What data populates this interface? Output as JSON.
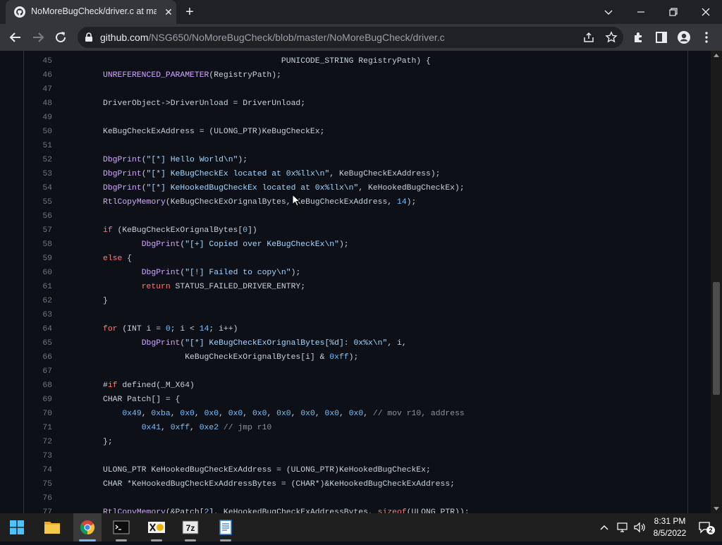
{
  "browser": {
    "tab": {
      "title": "NoMoreBugCheck/driver.c at ma",
      "favicon": "github-icon"
    },
    "new_tab": "+",
    "omnibox": {
      "url_host": "github.com",
      "url_path": "/NSG650/NoMoreBugCheck/blob/master/NoMoreBugCheck/driver.c"
    },
    "toolbar_icons": [
      "back-icon",
      "forward-icon",
      "reload-icon",
      "lock-icon",
      "share-icon",
      "star-icon",
      "extensions-icon",
      "side-panel-icon",
      "profile-icon",
      "menu-icon"
    ]
  },
  "code": {
    "lines": [
      {
        "n": "45",
        "html": "                                     PUNICODE_STRING RegistryPath) {"
      },
      {
        "n": "46",
        "html": "<span class=\"fn\">UNREFERENCED_PARAMETER</span>(RegistryPath);"
      },
      {
        "n": "47",
        "html": ""
      },
      {
        "n": "48",
        "html": "DriverObject-&gt;DriverUnload = DriverUnload;"
      },
      {
        "n": "49",
        "html": ""
      },
      {
        "n": "50",
        "html": "KeBugCheckExAddress = (ULONG_PTR)KeBugCheckEx;"
      },
      {
        "n": "51",
        "html": ""
      },
      {
        "n": "52",
        "html": "<span class=\"fn\">DbgPrint</span>(<span class=\"st\">\"[*] Hello World\\n\"</span>);"
      },
      {
        "n": "53",
        "html": "<span class=\"fn\">DbgPrint</span>(<span class=\"st\">\"[*] KeBugCheckEx located at 0x%llx\\n\"</span>, KeBugCheckExAddress);"
      },
      {
        "n": "54",
        "html": "<span class=\"fn\">DbgPrint</span>(<span class=\"st\">\"[*] KeHookedBugCheckEx located at 0x%llx\\n\"</span>, KeHookedBugCheckEx);"
      },
      {
        "n": "55",
        "html": "<span class=\"fn\">RtlCopyMemory</span>(KeBugCheckExOrignalBytes, KeBugCheckExAddress, <span class=\"nu\">14</span>);"
      },
      {
        "n": "56",
        "html": ""
      },
      {
        "n": "57",
        "html": "<span class=\"kw\">if</span> (KeBugCheckExOrignalBytes[<span class=\"nu\">0</span>])"
      },
      {
        "n": "58",
        "html": "        <span class=\"fn\">DbgPrint</span>(<span class=\"st\">\"[+] Copied over KeBugCheckEx\\n\"</span>);"
      },
      {
        "n": "59",
        "html": "<span class=\"kw\">else</span> {"
      },
      {
        "n": "60",
        "html": "        <span class=\"fn\">DbgPrint</span>(<span class=\"st\">\"[!] Failed to copy\\n\"</span>);"
      },
      {
        "n": "61",
        "html": "        <span class=\"kw\">return</span> STATUS_FAILED_DRIVER_ENTRY;"
      },
      {
        "n": "62",
        "html": "}"
      },
      {
        "n": "63",
        "html": ""
      },
      {
        "n": "64",
        "html": "<span class=\"kw\">for</span> (INT i = <span class=\"nu\">0</span>; i &lt; <span class=\"nu\">14</span>; i++)"
      },
      {
        "n": "65",
        "html": "        <span class=\"fn\">DbgPrint</span>(<span class=\"st\">\"[*] KeBugCheckExOrignalBytes[%d]: 0x%x\\n\"</span>, i,"
      },
      {
        "n": "66",
        "html": "                 KeBugCheckExOrignalBytes[i] &amp; <span class=\"nu\">0xff</span>);"
      },
      {
        "n": "67",
        "html": ""
      },
      {
        "n": "68",
        "html": "#<span class=\"kw\">if</span> defined(_M_X64)"
      },
      {
        "n": "69",
        "html": "CHAR Patch[] = {"
      },
      {
        "n": "70",
        "html": "    <span class=\"nu\">0x49</span>, <span class=\"nu\">0xba</span>, <span class=\"nu\">0x0</span>, <span class=\"nu\">0x0</span>, <span class=\"nu\">0x0</span>, <span class=\"nu\">0x0</span>, <span class=\"nu\">0x0</span>, <span class=\"nu\">0x0</span>, <span class=\"nu\">0x0</span>, <span class=\"nu\">0x0</span>, <span class=\"cm\">// mov r10, address</span>"
      },
      {
        "n": "71",
        "html": "        <span class=\"nu\">0x41</span>, <span class=\"nu\">0xff</span>, <span class=\"nu\">0xe2</span> <span class=\"cm\">// jmp r10</span>"
      },
      {
        "n": "72",
        "html": "};"
      },
      {
        "n": "73",
        "html": ""
      },
      {
        "n": "74",
        "html": "ULONG_PTR KeHookedBugCheckExAddress = (ULONG_PTR)KeHookedBugCheckEx;"
      },
      {
        "n": "75",
        "html": "CHAR *KeHookedBugCheckExAddressBytes = (CHAR*)&amp;KeHookedBugCheckExAddress;"
      },
      {
        "n": "76",
        "html": ""
      },
      {
        "n": "77",
        "html": "<span class=\"fn\">RtlCopyMemory</span>(&amp;Patch[<span class=\"nu\">2</span>], KeHookedBugCheckExAddressBytes, <span class=\"kw\">sizeof</span>(ULONG_PTR));"
      }
    ]
  },
  "taskbar": {
    "apps": [
      {
        "name": "start-button",
        "icon": "windows-icon"
      },
      {
        "name": "file-explorer",
        "icon": "folder-icon"
      },
      {
        "name": "chrome",
        "icon": "chrome-icon",
        "active": true
      },
      {
        "name": "terminal",
        "icon": "terminal-icon"
      },
      {
        "name": "xvd-app",
        "icon": "app-icon"
      },
      {
        "name": "7zip",
        "icon": "7zip-icon",
        "label": "7z"
      },
      {
        "name": "notepad",
        "icon": "notepad-icon"
      }
    ],
    "clock": {
      "time": "8:31 PM",
      "date": "8/5/2022"
    },
    "notification_count": "2"
  }
}
